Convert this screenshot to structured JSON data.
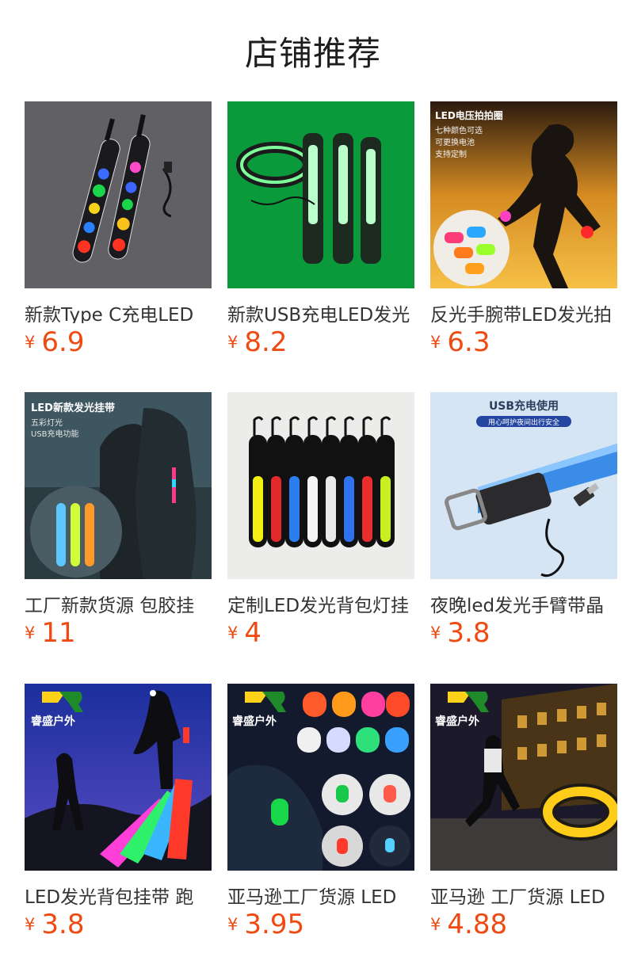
{
  "header": {
    "title": "店铺推荐"
  },
  "currency_symbol": "¥",
  "price_color": "#ee4a12",
  "products": [
    {
      "name": "新款Type C充电LED",
      "price": "6.9",
      "image_icon": "led-strap-image"
    },
    {
      "name": "新款USB充电LED发光",
      "price": "8.2",
      "image_icon": "green-led-strap-image"
    },
    {
      "name": "反光手腕带LED发光拍",
      "price": "6.3",
      "image_icon": "runner-wristband-image",
      "image_text": {
        "title": "LED电压拍拍圈",
        "lines": [
          "七种颜色可选",
          "可更换电池",
          "支持定制"
        ]
      }
    },
    {
      "name": "工厂新款货源 包胶挂",
      "price": "11",
      "image_icon": "backpack-hiker-image",
      "image_text": {
        "title": "LED新款发光挂带",
        "lines": [
          "五彩灯光",
          "USB充电功能"
        ]
      }
    },
    {
      "name": "定制LED发光背包灯挂",
      "price": "4",
      "image_icon": "colored-strap-row-image"
    },
    {
      "name": "夜晚led发光手臂带晶",
      "price": "3.8",
      "image_icon": "usb-armband-image",
      "image_text": {
        "title": "USB充电使用",
        "lines": [
          "用心呵护夜间出行安全"
        ]
      }
    },
    {
      "name": "LED发光背包挂带 跑",
      "price": "3.8",
      "image_icon": "night-hikers-image",
      "image_text": {
        "title": "睿盛户外",
        "lines": []
      }
    },
    {
      "name": "亚马逊工厂货源 LED",
      "price": "3.95",
      "image_icon": "armband-clips-image",
      "image_text": {
        "title": "睿盛户外",
        "lines": []
      }
    },
    {
      "name": "亚马逊 工厂货源 LED",
      "price": "4.88",
      "image_icon": "street-runner-image",
      "image_text": {
        "title": "睿盛户外",
        "lines": []
      }
    }
  ]
}
